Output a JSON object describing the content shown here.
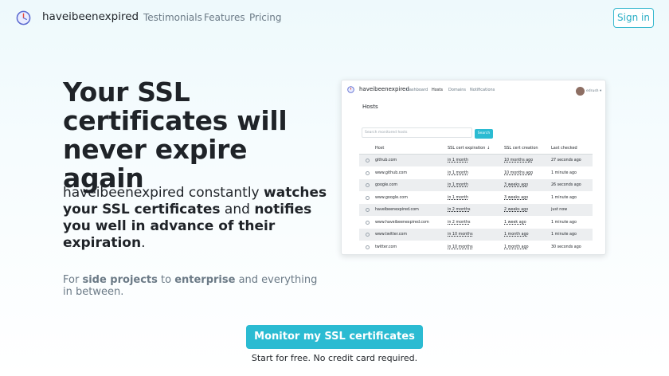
{
  "nav": {
    "brand": "haveibeenexpired",
    "links": [
      "Testimonials",
      "Features",
      "Pricing"
    ],
    "signin": "Sign in"
  },
  "hero": {
    "headline": "Your SSL certificates will never expire again",
    "desc_1": "haveibeenexpired constantly ",
    "desc_2": "watches your SSL certificates",
    "desc_3": " and ",
    "desc_4": "notifies you well in advance of their expiration",
    "desc_5": ".",
    "for_1": "For ",
    "for_2": "side projects",
    "for_3": " to ",
    "for_4": "enterprise",
    "for_5": " and everything in between.",
    "cta": "Monitor my SSL certificates",
    "cta_sub": "Start for free. No credit card required."
  },
  "screenshot": {
    "brand": "haveibeenexpired",
    "nav": [
      "Dashboard",
      "Hosts",
      "Domains",
      "Notifications"
    ],
    "user": "edrush",
    "title": "Hosts",
    "search_placeholder": "Search monitored hosts",
    "search_button": "Search",
    "columns": [
      "Host",
      "SSL cert expiration ↓",
      "SSL cert creation",
      "Last checked"
    ],
    "rows": [
      {
        "host": "github.com",
        "expiration": "in 1 month",
        "creation": "10 months ago",
        "checked": "27 seconds ago"
      },
      {
        "host": "www.github.com",
        "expiration": "in 1 month",
        "creation": "10 months ago",
        "checked": "1 minute ago"
      },
      {
        "host": "google.com",
        "expiration": "in 1 month",
        "creation": "3 weeks ago",
        "checked": "26 seconds ago"
      },
      {
        "host": "www.google.com",
        "expiration": "in 1 month",
        "creation": "3 weeks ago",
        "checked": "1 minute ago"
      },
      {
        "host": "haveibeenexpired.com",
        "expiration": "in 2 months",
        "creation": "2 weeks ago",
        "checked": "just now"
      },
      {
        "host": "www.haveibeenexpired.com",
        "expiration": "in 2 months",
        "creation": "1 week ago",
        "checked": "1 minute ago"
      },
      {
        "host": "www.twitter.com",
        "expiration": "in 10 months",
        "creation": "1 month ago",
        "checked": "1 minute ago"
      },
      {
        "host": "twitter.com",
        "expiration": "in 10 months",
        "creation": "1 month ago",
        "checked": "30 seconds ago"
      }
    ]
  },
  "colors": {
    "accent": "#2bbbd2",
    "text": "#1f2328",
    "muted": "#6b7a86"
  }
}
